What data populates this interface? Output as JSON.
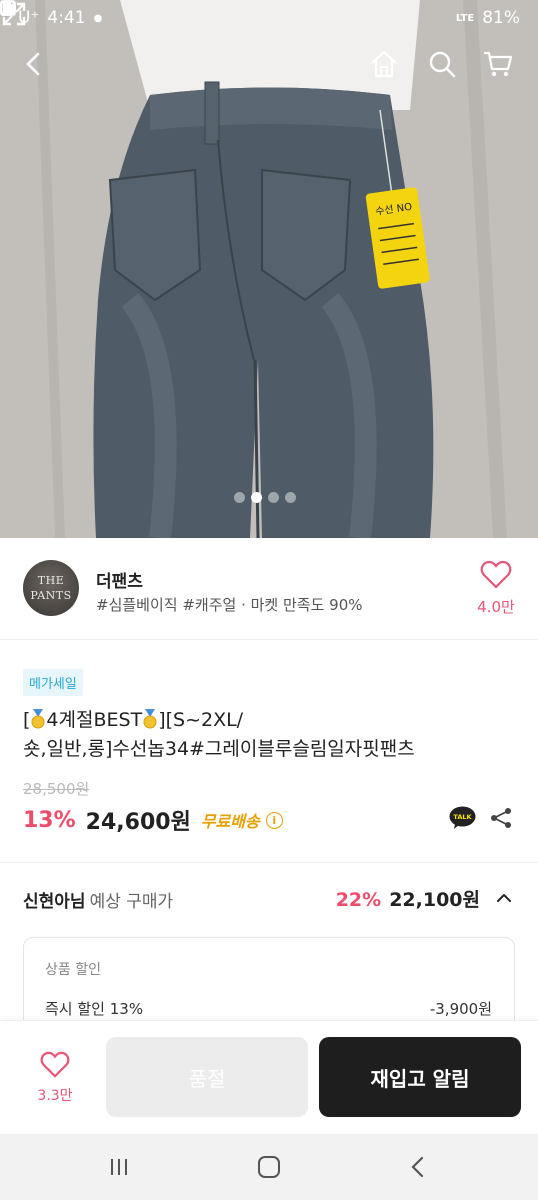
{
  "status_bar": {
    "carrier": "U⁺",
    "time": "4:41",
    "network": "LTE",
    "battery": "81%"
  },
  "hero": {
    "image_count": 4,
    "active_index": 1
  },
  "store": {
    "avatar_line1": "THE",
    "avatar_line2": "PANTS",
    "name": "더팬츠",
    "description": "#심플베이직 #캐주얼 · 마켓 만족도 90%",
    "like_count": "4.0만"
  },
  "product": {
    "badge": "메가세일",
    "title_part1": "[",
    "title_part2": "4계절BEST",
    "title_part3": "][S~2XL/",
    "title_line2": "숏,일반,롱]수선놉34#그레이블루슬림일자핏팬츠",
    "original_price": "28,500원",
    "discount": "13%",
    "price": "24,600원",
    "shipping": "무료배송",
    "info_icon": "i"
  },
  "member": {
    "name": "신현아님",
    "label": "예상 구매가",
    "discount": "22%",
    "price": "22,100원"
  },
  "discount_box": {
    "header": "상품 할인",
    "item_label": "즉시 할인 13%",
    "item_amount": "-3,900원"
  },
  "action_bar": {
    "like_count": "3.3만",
    "soldout_label": "품절",
    "restock_label": "재입고 알림"
  },
  "tag_text": "수선 NO"
}
